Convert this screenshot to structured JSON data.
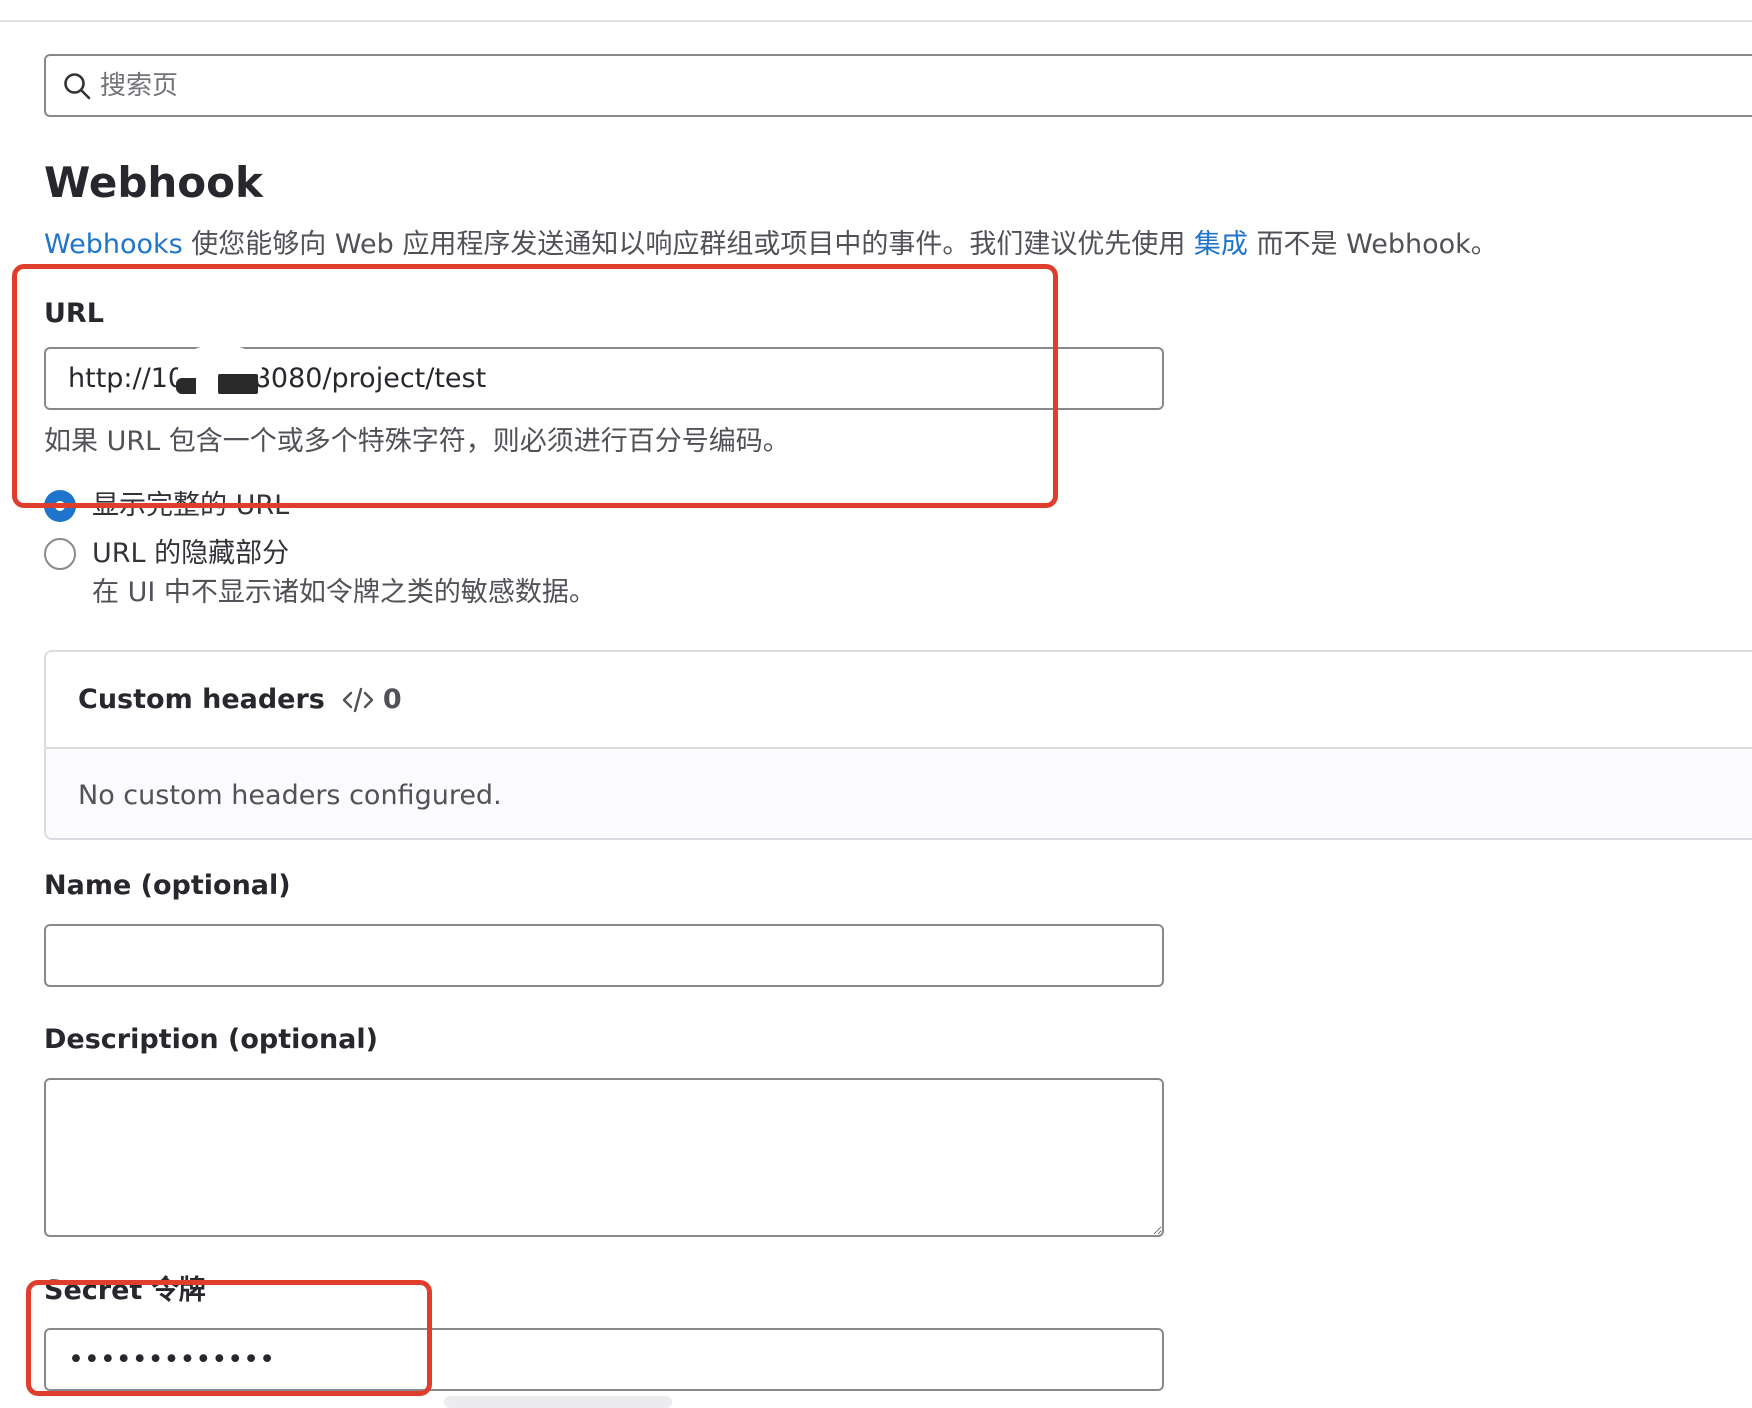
{
  "search": {
    "placeholder": "搜索页",
    "icon": "search-icon"
  },
  "page": {
    "title": "Webhook",
    "intro": {
      "link1": "Webhooks",
      "text1": " 使您能够向 Web 应用程序发送通知以响应群组或项目中的事件。我们建议优先使用 ",
      "link2": "集成",
      "text2": " 而不是 Webhook。"
    }
  },
  "url_field": {
    "label": "URL",
    "value": "http://10.      .8080/project/test",
    "help": "如果 URL 包含一个或多个特殊字符，则必须进行百分号编码。"
  },
  "url_display": {
    "options": [
      {
        "label": "显示完整的 URL",
        "checked": true
      },
      {
        "label": "URL 的隐藏部分",
        "checked": false,
        "help": "在 UI 中不显示诸如令牌之类的敏感数据。"
      }
    ]
  },
  "custom_headers": {
    "title": "Custom headers",
    "icon": "code-icon",
    "count": "0",
    "empty_text": "No custom headers configured."
  },
  "name_field": {
    "label": "Name (optional)",
    "value": ""
  },
  "description_field": {
    "label": "Description (optional)",
    "value": ""
  },
  "secret_field": {
    "label": "Secret 令牌",
    "value": "•••••••••••••"
  },
  "colors": {
    "link": "#1f75cb",
    "annotation": "#e03e2d",
    "radio_checked": "#1f75cb"
  }
}
